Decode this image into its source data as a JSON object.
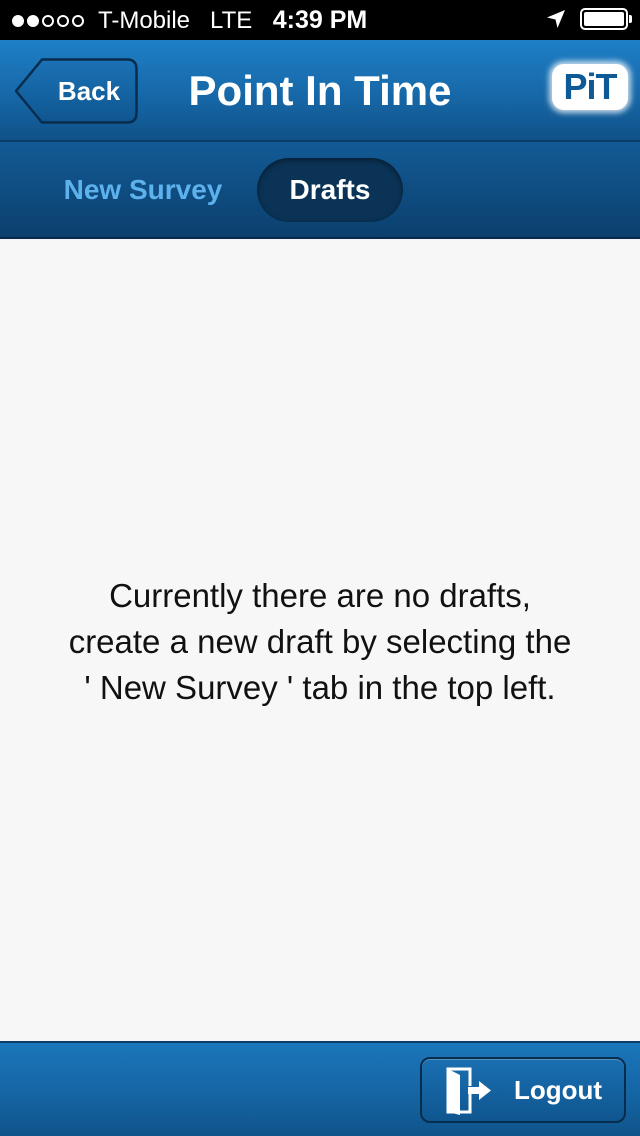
{
  "status_bar": {
    "carrier": "T-Mobile",
    "network": "LTE",
    "time": "4:39 PM",
    "signal_strength": 2,
    "signal_total": 5
  },
  "nav_bar": {
    "back_label": "Back",
    "title": "Point In Time",
    "logo_text": "PiT"
  },
  "tabs": [
    {
      "label": "New Survey",
      "selected": false
    },
    {
      "label": "Drafts",
      "selected": true
    }
  ],
  "content": {
    "empty_message": "Currently there are no drafts,\ncreate a new draft by selecting the\n' New Survey ' tab in the top left."
  },
  "bottom_bar": {
    "logout_label": "Logout"
  },
  "colors": {
    "nav_blue": "#1768a8",
    "tab_bar_dark": "#0e4a7d",
    "tab_inactive_text": "#5db2ee",
    "content_bg": "#f7f7f7"
  },
  "icons": {
    "location": "location-arrow-icon",
    "battery": "battery-icon",
    "logout": "exit-door-icon"
  }
}
